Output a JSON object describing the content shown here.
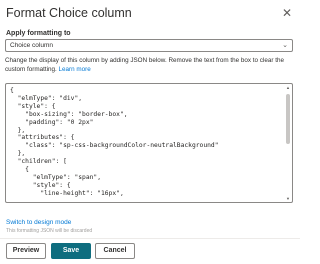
{
  "dialog": {
    "title": "Format Choice column",
    "close_glyph": "✕"
  },
  "apply_formatting": {
    "label": "Apply formatting to",
    "selected": "Choice column",
    "chevron_glyph": "⌄"
  },
  "description": {
    "text": "Change the display of this column by adding JSON below. Remove the text from the box to clear the custom formatting. ",
    "link": "Learn more"
  },
  "json_editor": {
    "content": "{\n  \"elmType\": \"div\",\n  \"style\": {\n    \"box-sizing\": \"border-box\",\n    \"padding\": \"0 2px\"\n  },\n  \"attributes\": {\n    \"class\": \"sp-css-backgroundColor-neutralBackground\"\n  },\n  \"children\": [\n    {\n      \"elmType\": \"span\",\n      \"style\": {\n        \"line-height\": \"16px\","
  },
  "switch_link": "Switch to design mode",
  "switch_note": "This formatting JSON will be discarded",
  "buttons": {
    "preview": "Preview",
    "save": "Save",
    "cancel": "Cancel"
  },
  "colors": {
    "accent": "#0e6d7f",
    "link": "#0078d4"
  }
}
